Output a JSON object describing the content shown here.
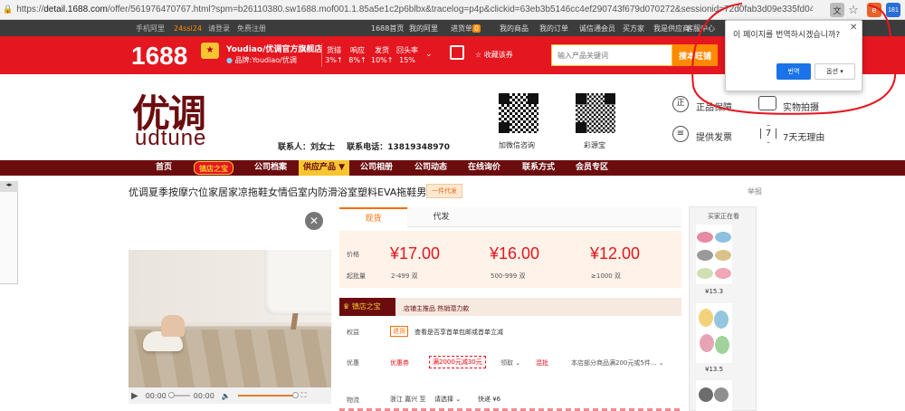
{
  "browser": {
    "url_scheme": "https://",
    "url_host": "detail.1688.com",
    "url_rest": "/offer/561976470767.html?spm=b26110380.sw1688.mof001.1.85a5e1c2p6blbx&tracelog=p4p&clickid=63eb3b5146cc4ef290743f679d070272&sessionid=72d0fab3d09e335fd049f1e00b7a...",
    "ext_badge": "181"
  },
  "topbar": {
    "left": [
      "手机阿里",
      "24ssi24",
      "请登录",
      "免费注册"
    ],
    "right": [
      "1688首页",
      "我的阿里",
      "进货单",
      "0",
      "我的商品",
      "我的订单",
      "诚信通会员",
      "买方家",
      "我是供应商",
      "客服中心"
    ]
  },
  "header": {
    "logo": "1688",
    "store_name": "Youdiao/优调官方旗舰店",
    "brand_prefix": "品牌:",
    "brand": "Youdiao/优调",
    "stats": [
      {
        "label": "货描",
        "value": "3%↑"
      },
      {
        "label": "响应",
        "value": "8%↑"
      },
      {
        "label": "发货",
        "value": "10%↑"
      },
      {
        "label": "回头率",
        "value": "15%"
      }
    ],
    "favorite": "收藏该券",
    "search_placeholder": "输入产品关键词",
    "search_button": "搜本旺铺"
  },
  "banner": {
    "logo_cn": "优调",
    "logo_en": "udtune",
    "contact_label": "联系人：",
    "contact_name": "刘女士",
    "phone_label": "联系电话：",
    "phone": "13819348970",
    "qr1_label": "加微信咨询",
    "qr2_label": "彩源宝",
    "services": [
      "正品保障",
      "实物拍摄",
      "提供发票",
      "7天无理由"
    ],
    "service_icons": [
      "正",
      "⌷",
      "≡",
      "7"
    ]
  },
  "nav": {
    "items": [
      "首页",
      "镇店之宝",
      "公司档案",
      "供应产品 ▼",
      "公司相册",
      "公司动态",
      "在线询价",
      "联系方式",
      "会员专区"
    ]
  },
  "product": {
    "title": "优调夏季按摩穴位家居家凉拖鞋女情侣室内防滑浴室塑料EVA拖鞋男",
    "tag": "一件代发",
    "report": "举报",
    "tabs": [
      "现货",
      "代发"
    ],
    "price_label": "价格",
    "moq_label": "起批量",
    "prices": [
      {
        "price": "¥17.00",
        "range": "2-499 双"
      },
      {
        "price": "¥16.00",
        "range": "500-999 双"
      },
      {
        "price": "¥12.00",
        "range": "≥1000 双"
      }
    ],
    "promo_badge": "镇店之宝",
    "promo_text": "店铺主推品 热销潜力款",
    "rights_label": "权益",
    "rights_tag": "退货",
    "rights_text": "查看是否享首单包邮或首单立减",
    "discount_label": "优惠",
    "coupon_label": "优惠券",
    "coupon_value": "满2000元减30元",
    "coupon_action": "领取",
    "mix_label": "混批",
    "mix_text": "本店部分商品满200元或5件...",
    "logistics_label": "物流",
    "logistics_from": "浙江 嘉兴",
    "logistics_to_word": "至",
    "logistics_to": "请选择",
    "express": "快递 ¥6"
  },
  "video": {
    "time_current": "00:00",
    "time_total": "00:00"
  },
  "sidebar": {
    "title": "买家正在看",
    "items": [
      {
        "price": "¥15.3"
      },
      {
        "price": "¥13.5"
      }
    ]
  },
  "translate_popup": {
    "message": "이 페이지를 번역하시겠습니까?",
    "translate": "번역",
    "options": "옵션"
  }
}
